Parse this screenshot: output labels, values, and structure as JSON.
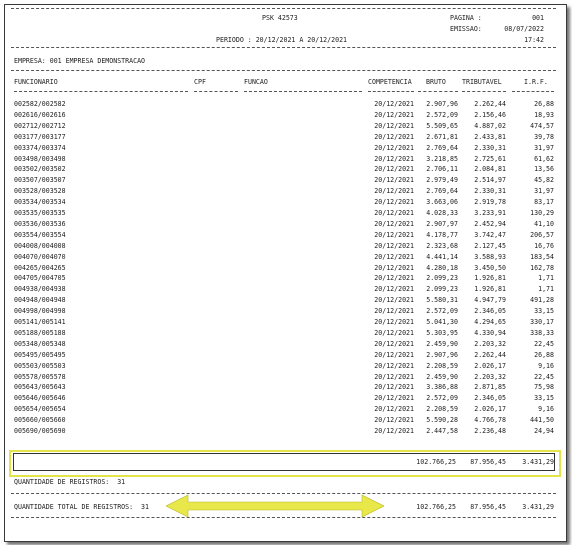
{
  "header": {
    "report_id": "PSK 42573",
    "pagina_label": "PAGINA :",
    "pagina_value": "001",
    "emissao_label": "EMISSAO:",
    "emissao_value": "08/07/2022",
    "periodo": "PERIODO : 20/12/2021 A 20/12/2021",
    "hora": "17:42",
    "empresa": "EMPRESA: 001 EMPRESA DEMONSTRACAO"
  },
  "columns": {
    "funcionario": "FUNCIONARIO",
    "cpf": "CPF",
    "funcao": "FUNCAO",
    "competencia": "COMPETENCIA",
    "bruto": "BRUTO",
    "tributavel": "TRIBUTAVEL",
    "irf": "I.R.F."
  },
  "rows": [
    {
      "func": "002582/002582",
      "comp": "20/12/2021",
      "bruto": "2.907,96",
      "trib": "2.262,44",
      "irf": "26,88"
    },
    {
      "func": "002616/002616",
      "comp": "20/12/2021",
      "bruto": "2.572,09",
      "trib": "2.156,46",
      "irf": "18,93"
    },
    {
      "func": "002712/002712",
      "comp": "20/12/2021",
      "bruto": "5.509,65",
      "trib": "4.887,02",
      "irf": "474,57"
    },
    {
      "func": "003177/003177",
      "comp": "20/12/2021",
      "bruto": "2.671,81",
      "trib": "2.433,81",
      "irf": "39,78"
    },
    {
      "func": "003374/003374",
      "comp": "20/12/2021",
      "bruto": "2.769,64",
      "trib": "2.330,31",
      "irf": "31,97"
    },
    {
      "func": "003498/003498",
      "comp": "20/12/2021",
      "bruto": "3.218,85",
      "trib": "2.725,61",
      "irf": "61,62"
    },
    {
      "func": "003502/003502",
      "comp": "20/12/2021",
      "bruto": "2.706,11",
      "trib": "2.084,81",
      "irf": "13,56"
    },
    {
      "func": "003507/003507",
      "comp": "20/12/2021",
      "bruto": "2.979,49",
      "trib": "2.514,97",
      "irf": "45,82"
    },
    {
      "func": "003528/003528",
      "comp": "20/12/2021",
      "bruto": "2.769,64",
      "trib": "2.330,31",
      "irf": "31,97"
    },
    {
      "func": "003534/003534",
      "comp": "20/12/2021",
      "bruto": "3.663,06",
      "trib": "2.919,78",
      "irf": "83,17"
    },
    {
      "func": "003535/003535",
      "comp": "20/12/2021",
      "bruto": "4.028,33",
      "trib": "3.233,91",
      "irf": "130,29"
    },
    {
      "func": "003536/003536",
      "comp": "20/12/2021",
      "bruto": "2.907,97",
      "trib": "2.452,94",
      "irf": "41,10"
    },
    {
      "func": "003554/003554",
      "comp": "20/12/2021",
      "bruto": "4.178,77",
      "trib": "3.742,47",
      "irf": "206,57"
    },
    {
      "func": "004008/004008",
      "comp": "20/12/2021",
      "bruto": "2.323,68",
      "trib": "2.127,45",
      "irf": "16,76"
    },
    {
      "func": "004070/004070",
      "comp": "20/12/2021",
      "bruto": "4.441,14",
      "trib": "3.588,93",
      "irf": "183,54"
    },
    {
      "func": "004265/004265",
      "comp": "20/12/2021",
      "bruto": "4.280,18",
      "trib": "3.450,50",
      "irf": "162,78"
    },
    {
      "func": "004705/004705",
      "comp": "20/12/2021",
      "bruto": "2.099,23",
      "trib": "1.926,81",
      "irf": "1,71"
    },
    {
      "func": "004938/004938",
      "comp": "20/12/2021",
      "bruto": "2.099,23",
      "trib": "1.926,81",
      "irf": "1,71"
    },
    {
      "func": "004948/004948",
      "comp": "20/12/2021",
      "bruto": "5.580,31",
      "trib": "4.947,79",
      "irf": "491,28"
    },
    {
      "func": "004998/004998",
      "comp": "20/12/2021",
      "bruto": "2.572,09",
      "trib": "2.346,05",
      "irf": "33,15"
    },
    {
      "func": "005141/005141",
      "comp": "20/12/2021",
      "bruto": "5.041,30",
      "trib": "4.294,65",
      "irf": "330,17"
    },
    {
      "func": "005188/005188",
      "comp": "20/12/2021",
      "bruto": "5.303,95",
      "trib": "4.330,94",
      "irf": "338,33"
    },
    {
      "func": "005348/005348",
      "comp": "20/12/2021",
      "bruto": "2.459,90",
      "trib": "2.203,32",
      "irf": "22,45"
    },
    {
      "func": "005495/005495",
      "comp": "20/12/2021",
      "bruto": "2.907,96",
      "trib": "2.262,44",
      "irf": "26,88"
    },
    {
      "func": "005503/005503",
      "comp": "20/12/2021",
      "bruto": "2.208,59",
      "trib": "2.026,17",
      "irf": "9,16"
    },
    {
      "func": "005578/005578",
      "comp": "20/12/2021",
      "bruto": "2.459,90",
      "trib": "2.203,32",
      "irf": "22,45"
    },
    {
      "func": "005643/005643",
      "comp": "20/12/2021",
      "bruto": "3.386,88",
      "trib": "2.871,85",
      "irf": "75,98"
    },
    {
      "func": "005646/005646",
      "comp": "20/12/2021",
      "bruto": "2.572,09",
      "trib": "2.346,05",
      "irf": "33,15"
    },
    {
      "func": "005654/005654",
      "comp": "20/12/2021",
      "bruto": "2.208,59",
      "trib": "2.026,17",
      "irf": "9,16"
    },
    {
      "func": "005660/005660",
      "comp": "20/12/2021",
      "bruto": "5.590,28",
      "trib": "4.766,78",
      "irf": "441,50"
    },
    {
      "func": "005690/005690",
      "comp": "20/12/2021",
      "bruto": "2.447,58",
      "trib": "2.236,48",
      "irf": "24,94"
    }
  ],
  "totals": {
    "bruto": "102.766,25",
    "trib": "87.956,45",
    "irf": "3.431,29"
  },
  "qtd_registros": "QUANTIDADE DE REGISTROS:  31",
  "qtd_total": {
    "label": "QUANTIDADE TOTAL DE REGISTROS:  31",
    "bruto": "102.766,25",
    "trib": "87.956,45",
    "irf": "3.431,29"
  },
  "colors": {
    "highlight": "#e3e34a",
    "arrow": "#e8e84a",
    "border": "#333333"
  }
}
